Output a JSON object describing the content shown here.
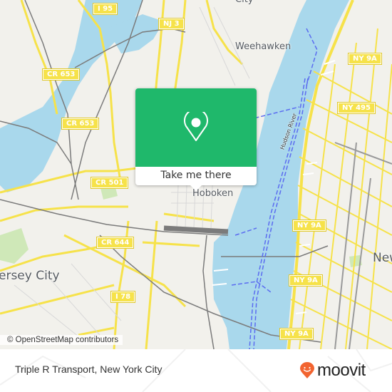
{
  "map": {
    "place_labels": [
      {
        "id": "city-top",
        "text": "City"
      },
      {
        "id": "weehawken",
        "text": "Weehawken"
      },
      {
        "id": "hoboken",
        "text": "Hoboken"
      },
      {
        "id": "jersey-city",
        "text": "ersey City"
      },
      {
        "id": "new-york",
        "text": "New"
      }
    ],
    "road_shields": [
      {
        "id": "i95",
        "text": "I 95"
      },
      {
        "id": "nj3",
        "text": "NJ 3"
      },
      {
        "id": "cr653-a",
        "text": "CR 653"
      },
      {
        "id": "cr653-b",
        "text": "CR 653"
      },
      {
        "id": "cr501",
        "text": "CR 501"
      },
      {
        "id": "cr644",
        "text": "CR 644"
      },
      {
        "id": "i78",
        "text": "I 78"
      },
      {
        "id": "ny9a-a",
        "text": "NY 9A"
      },
      {
        "id": "ny495",
        "text": "NY 495"
      },
      {
        "id": "ny9a-b",
        "text": "NY 9A"
      },
      {
        "id": "ny9a-c",
        "text": "NY 9A"
      },
      {
        "id": "ny9a-d",
        "text": "NY 9A"
      }
    ],
    "river_label": "Hudson River",
    "colors": {
      "land": "#f2f1ec",
      "water": "#a9d8ec",
      "road": "#f6e24a",
      "rail": "#7b7b7b",
      "ferry": "#5b6cf0",
      "park": "#cfe8b8"
    }
  },
  "popup": {
    "icon": "map-pin-icon",
    "button_label": "Take me there",
    "color": "#1fb86b"
  },
  "attribution": "© OpenStreetMap contributors",
  "footer": {
    "title": "Triple R Transport, New York City",
    "logo_text": "moovit",
    "logo_color": "#f26430"
  }
}
